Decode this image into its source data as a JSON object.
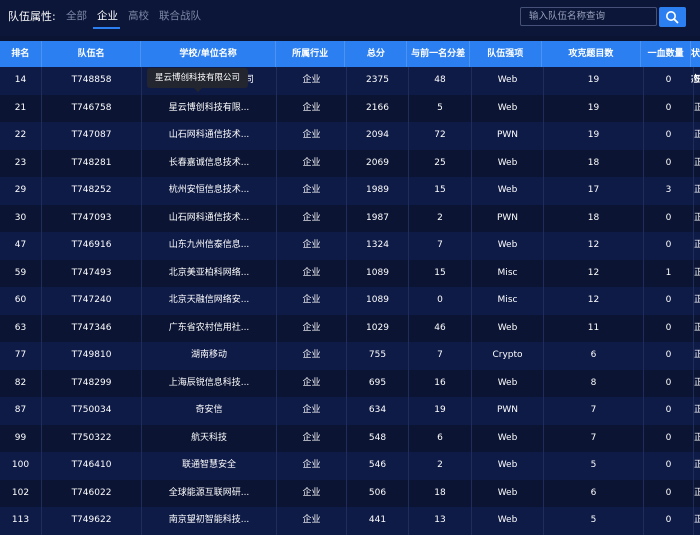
{
  "filter": {
    "label": "队伍属性:",
    "tabs": [
      "全部",
      "企业",
      "高校",
      "联合战队"
    ],
    "active_tab": 1
  },
  "search": {
    "placeholder": "输入队伍名称查询",
    "icon": "search-icon"
  },
  "table": {
    "headers": [
      "排名",
      "队伍名",
      "学校/单位名称",
      "所属行业",
      "总分",
      "与前一名分差",
      "队伍强项",
      "攻克题目数",
      "一血数量",
      "状态"
    ],
    "rows": [
      [
        "14",
        "T748858",
        "星云博创科技有限公司",
        "企业",
        "2375",
        "48",
        "Web",
        "19",
        "0",
        "正常"
      ],
      [
        "21",
        "T746758",
        "星云博创科技有限...",
        "企业",
        "2166",
        "5",
        "Web",
        "19",
        "0",
        "正常"
      ],
      [
        "22",
        "T747087",
        "山石网科通信技术...",
        "企业",
        "2094",
        "72",
        "PWN",
        "19",
        "0",
        "正常"
      ],
      [
        "23",
        "T748281",
        "长春嘉诚信息技术...",
        "企业",
        "2069",
        "25",
        "Web",
        "18",
        "0",
        "正常"
      ],
      [
        "29",
        "T748252",
        "杭州安恒信息技术...",
        "企业",
        "1989",
        "15",
        "Web",
        "17",
        "3",
        "正常"
      ],
      [
        "30",
        "T747093",
        "山石网科通信技术...",
        "企业",
        "1987",
        "2",
        "PWN",
        "18",
        "0",
        "正常"
      ],
      [
        "47",
        "T746916",
        "山东九州信泰信息...",
        "企业",
        "1324",
        "7",
        "Web",
        "12",
        "0",
        "正常"
      ],
      [
        "59",
        "T747493",
        "北京美亚柏科网络...",
        "企业",
        "1089",
        "15",
        "Misc",
        "12",
        "1",
        "正常"
      ],
      [
        "60",
        "T747240",
        "北京天融信网络安...",
        "企业",
        "1089",
        "0",
        "Misc",
        "12",
        "0",
        "正常"
      ],
      [
        "63",
        "T747346",
        "广东省农村信用社...",
        "企业",
        "1029",
        "46",
        "Web",
        "11",
        "0",
        "正常"
      ],
      [
        "77",
        "T749810",
        "湖南移动",
        "企业",
        "755",
        "7",
        "Crypto",
        "6",
        "0",
        "正常"
      ],
      [
        "82",
        "T748299",
        "上海辰锐信息科技...",
        "企业",
        "695",
        "16",
        "Web",
        "8",
        "0",
        "正常"
      ],
      [
        "87",
        "T750034",
        "奇安信",
        "企业",
        "634",
        "19",
        "PWN",
        "7",
        "0",
        "正常"
      ],
      [
        "99",
        "T750322",
        "航天科技",
        "企业",
        "548",
        "6",
        "Web",
        "7",
        "0",
        "正常"
      ],
      [
        "100",
        "T746410",
        "联通智慧安全",
        "企业",
        "546",
        "2",
        "Web",
        "5",
        "0",
        "正常"
      ],
      [
        "102",
        "T746022",
        "全球能源互联网研...",
        "企业",
        "506",
        "18",
        "Web",
        "6",
        "0",
        "正常"
      ],
      [
        "113",
        "T749622",
        "南京望初智能科技...",
        "企业",
        "441",
        "13",
        "Web",
        "5",
        "0",
        "正常"
      ]
    ]
  },
  "tooltip": {
    "text": "星云博创科技有限公司"
  },
  "colors": {
    "background": "#0b1433",
    "header": "#2c7ff0",
    "row_alt": "#0f1b47",
    "accent": "#2c7ff0"
  }
}
